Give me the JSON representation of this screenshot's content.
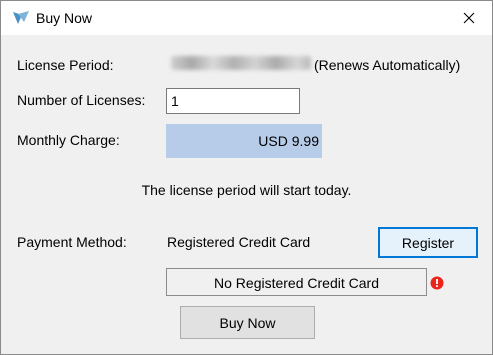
{
  "window": {
    "title": "Buy Now"
  },
  "license_period": {
    "label": "License Period:",
    "suffix": "(Renews Automatically)"
  },
  "licenses": {
    "label": "Number of Licenses:",
    "value": "1"
  },
  "monthly_charge": {
    "label": "Monthly Charge:",
    "value": "USD 9.99"
  },
  "notice": "The license period will start today.",
  "payment": {
    "label": "Payment Method:",
    "value": "Registered Credit Card",
    "register_label": "Register"
  },
  "card_status": "No Registered Credit Card",
  "buy_button": "Buy Now",
  "colors": {
    "charge_bg": "#b6cce8",
    "accent": "#0078d7",
    "warning": "#e8261c"
  },
  "icons": [
    "app-icon",
    "close-icon",
    "warning-icon"
  ]
}
